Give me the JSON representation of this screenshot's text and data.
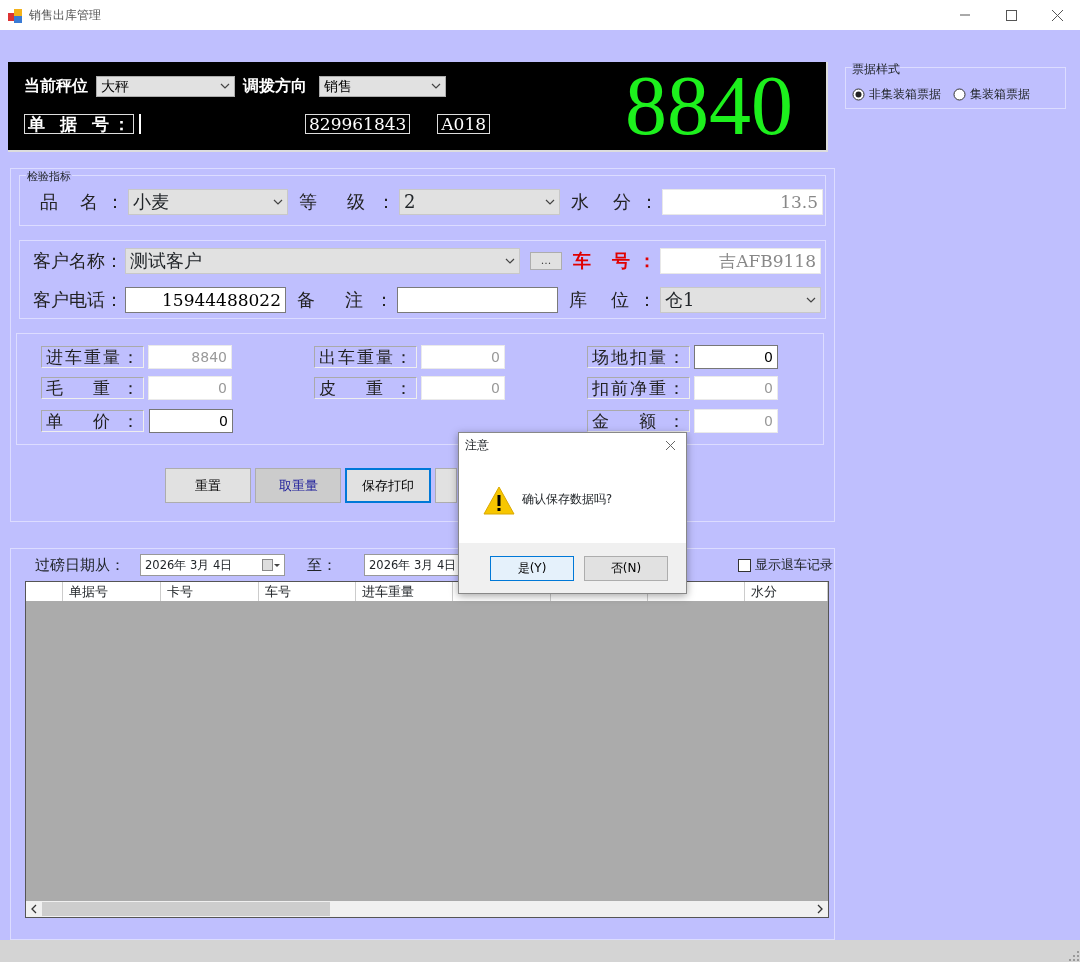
{
  "window": {
    "title": "销售出库管理"
  },
  "scale_panel": {
    "scale_label": "当前秤位",
    "scale_value": "大秤",
    "direction_label": "调拨方向",
    "direction_value": "销售",
    "doc_no_label": "单 据 号：",
    "doc_number": "829961843",
    "code": "A018",
    "weight": "8840"
  },
  "receipt_style": {
    "title": "票据样式",
    "options": [
      {
        "label": "非集装箱票据",
        "selected": true
      },
      {
        "label": "集装箱票据",
        "selected": false
      }
    ]
  },
  "inspection": {
    "title": "检验指标",
    "fields": [
      {
        "label": "品 名：",
        "kind": "select",
        "value": "小麦"
      },
      {
        "label": "等 级：",
        "kind": "select",
        "value": "2"
      },
      {
        "label": "水 分：",
        "kind": "input",
        "value": "13.5",
        "disabled": true
      }
    ]
  },
  "customer": {
    "fields": [
      {
        "label": "客户名称：",
        "kind": "select",
        "value": "测试客户",
        "required": false
      },
      {
        "label": "车 号：",
        "kind": "input",
        "value": "吉AFB9118",
        "disabled": true,
        "required": true
      },
      {
        "label": "客户电话：",
        "kind": "input",
        "value": "15944488022",
        "disabled": false,
        "required": false
      },
      {
        "label": "备 注：",
        "kind": "input",
        "disabled": false,
        "required": false
      },
      {
        "label": "库 位：",
        "kind": "select",
        "value": "仓1",
        "required": false
      }
    ],
    "browse_button": "..."
  },
  "weights": {
    "columns": [
      [
        {
          "label": "进车重量：",
          "value": "8840",
          "disabled": true
        },
        {
          "label": "毛 重：",
          "value": "0",
          "disabled": true
        },
        {
          "label": "单 价：",
          "value": "0",
          "disabled": false
        }
      ],
      [
        {
          "label": "出车重量：",
          "value": "0",
          "disabled": true
        },
        {
          "label": "皮 重：",
          "value": "0",
          "disabled": true
        }
      ],
      [
        {
          "label": "场地扣量：",
          "value": "0",
          "disabled": false
        },
        {
          "label": "扣前净重：",
          "value": "0",
          "disabled": true
        },
        {
          "label": "金 额：",
          "value": "0",
          "disabled": true
        }
      ]
    ]
  },
  "buttons": [
    {
      "label": "重置",
      "hovered": false,
      "focused": false
    },
    {
      "label": "取重量",
      "hovered": true,
      "focused": false
    },
    {
      "label": "保存打印",
      "hovered": false,
      "focused": true
    }
  ],
  "filter": {
    "from_label": "过磅日期从：",
    "from_date": "2026年 3月 4日",
    "to_label": "至：",
    "to_date": "2026年 3月 4日",
    "show_returns": {
      "label": "显示退车记录",
      "checked": false
    }
  },
  "table": {
    "columns": [
      "单据号",
      "卡号",
      "车号",
      "进车重量",
      "水分"
    ]
  },
  "dialog": {
    "title": "注意",
    "message": "确认保存数据吗?",
    "buttons": [
      {
        "label": "是(Y)",
        "focused": true
      },
      {
        "label": "否(N)",
        "focused": false
      }
    ]
  }
}
